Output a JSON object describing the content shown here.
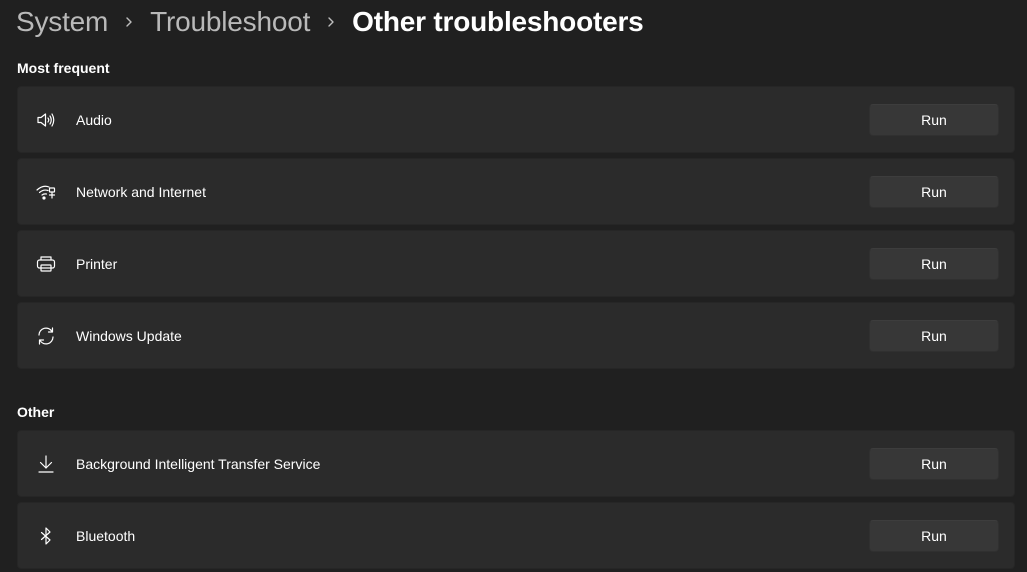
{
  "breadcrumb": {
    "items": [
      "System",
      "Troubleshoot"
    ],
    "current": "Other troubleshooters"
  },
  "sections": {
    "most_frequent": {
      "title": "Most frequent",
      "items": [
        {
          "label": "Audio",
          "icon": "speaker-icon",
          "button": "Run"
        },
        {
          "label": "Network and Internet",
          "icon": "network-icon",
          "button": "Run"
        },
        {
          "label": "Printer",
          "icon": "printer-icon",
          "button": "Run"
        },
        {
          "label": "Windows Update",
          "icon": "sync-icon",
          "button": "Run"
        }
      ]
    },
    "other": {
      "title": "Other",
      "items": [
        {
          "label": "Background Intelligent Transfer Service",
          "icon": "download-icon",
          "button": "Run"
        },
        {
          "label": "Bluetooth",
          "icon": "bluetooth-icon",
          "button": "Run"
        }
      ]
    }
  },
  "colors": {
    "background": "#202020",
    "card": "#2b2b2b",
    "button": "#373737",
    "text": "#ffffff",
    "muted": "#b9b9b9"
  }
}
